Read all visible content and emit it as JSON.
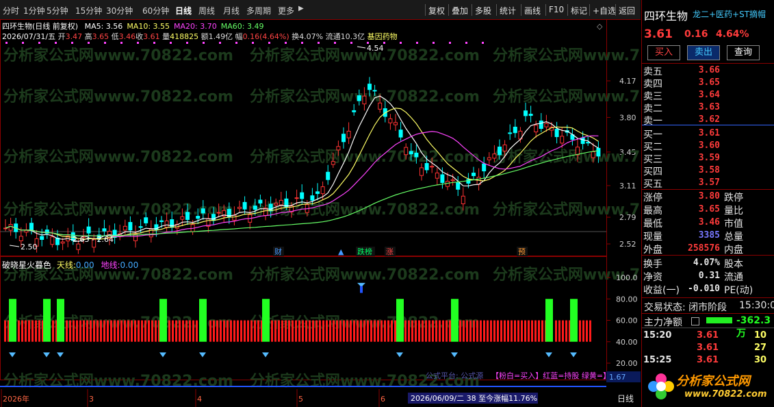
{
  "toolbar": {
    "tabs": [
      "分时",
      "1分钟",
      "5分钟",
      "15分钟",
      "30分钟",
      "60分钟",
      "日线",
      "周线",
      "月线",
      "多周期",
      "更多"
    ],
    "active_tab": "日线",
    "more_arrow": "▶",
    "right": [
      "复权",
      "叠加",
      "多股",
      "统计",
      "画线",
      "F10",
      "标记",
      "+自选",
      "返回"
    ]
  },
  "header": {
    "stock_name": "四环生物",
    "mode": "(日线 前复权)",
    "ma": [
      {
        "label": "MA5: 3.56",
        "color": "#ffffff"
      },
      {
        "label": "MA10: 3.55",
        "color": "#ffff66"
      },
      {
        "label": "MA20: 3.70",
        "color": "#ff44ff"
      },
      {
        "label": "MA60: 3.49",
        "color": "#66ff66"
      }
    ],
    "date": "2026/07/31/五",
    "open_label": "开",
    "open": "3.47",
    "high_label": "高",
    "high": "3.65",
    "low_label": "低",
    "low": "3.46",
    "close_label": "收",
    "close": "3.61",
    "vol_label": "量",
    "vol": "418825",
    "amount_label": "额",
    "amount": "1.49亿",
    "amp_label": "幅",
    "amp": "0.16(4.64%)",
    "turn_label": "换",
    "turn": "4.07%",
    "float_label": "流通",
    "float": "10.3亿",
    "sector": "基因药物"
  },
  "indicator": {
    "name": "破晓星火暮色",
    "line1_label": "天线:",
    "line1_val": "0.00",
    "line2_label": "地线:",
    "line2_val": "0.00"
  },
  "chart_data": {
    "type": "candlestick",
    "price_axis_ticks": [
      "4.17",
      "3.80",
      "3.45",
      "3.11",
      "2.79",
      "2.52"
    ],
    "indicator_axis_ticks": [
      "100.0",
      "80.00",
      "60.00",
      "40.00",
      "20.00"
    ],
    "x_axis_labels": [
      "2026年",
      "3",
      "4",
      "5",
      "6"
    ],
    "annotations": {
      "peak": "4.54",
      "low": "2.50",
      "range": "2.63 - 2.64"
    },
    "event_markers": [
      {
        "label": "财",
        "color": "#4499ff"
      },
      {
        "label": "跌榜",
        "color": "#00ff66"
      },
      {
        "label": "涨",
        "color": "#ff4444"
      },
      {
        "label": "预",
        "color": "#ff9933"
      }
    ],
    "series_colors": {
      "up": "#ff3333",
      "down": "#00ffff",
      "ma5": "#ffffff",
      "ma10": "#ffff66",
      "ma20": "#ff44ff",
      "ma60": "#66ff66",
      "ind_red": "#ff1a1a",
      "ind_green": "#22ff22"
    }
  },
  "bottom": {
    "status_hint": "1.67",
    "date_info": "2026/06/09/二 38 至今涨幅11.76%",
    "legend_text": "【粉白=买入】红蓝=持股 绿黄=】",
    "legend_prefix": "公式平台: 公式源",
    "period": "日线"
  },
  "right_panel": {
    "name": "四环生物",
    "tags": "龙二+医药+ST摘帽",
    "price": "3.61",
    "change": "0.16",
    "change_pct": "4.64%",
    "buttons": [
      "买入",
      "卖出",
      "查询"
    ],
    "sells": [
      [
        "卖五",
        "3.66"
      ],
      [
        "卖四",
        "3.65"
      ],
      [
        "卖三",
        "3.64"
      ],
      [
        "卖二",
        "3.63"
      ],
      [
        "卖一",
        "3.62"
      ]
    ],
    "buys": [
      [
        "买一",
        "3.61"
      ],
      [
        "买二",
        "3.60"
      ],
      [
        "买三",
        "3.59"
      ],
      [
        "买四",
        "3.58"
      ],
      [
        "买五",
        "3.57"
      ]
    ],
    "stats": [
      [
        "涨停",
        "3.80",
        "跌停"
      ],
      [
        "最高",
        "3.65",
        "量比"
      ],
      [
        "最低",
        "3.46",
        "市值"
      ],
      [
        "现量",
        "3385",
        "总量"
      ],
      [
        "外盘",
        "258576",
        "内盘"
      ]
    ],
    "stats2": [
      [
        "换手",
        "4.07%",
        "股本"
      ],
      [
        "净资",
        "0.31",
        "流通"
      ],
      [
        "收益(一)",
        "-0.010",
        "PE(动)"
      ]
    ],
    "trade_status": "交易状态: 闭市阶段",
    "trade_time": "15:30:0",
    "main_flow_label": "主力净额",
    "main_flow": "-362.3万",
    "ticks": [
      [
        "15:20",
        "3.61",
        "10"
      ],
      [
        "",
        "3.61",
        "27"
      ],
      [
        "15:25",
        "3.61",
        "30"
      ]
    ]
  },
  "watermark": "分析家公式网www.70822.com",
  "logo": {
    "title": "分析家公式网",
    "url": "www.70822.com"
  }
}
